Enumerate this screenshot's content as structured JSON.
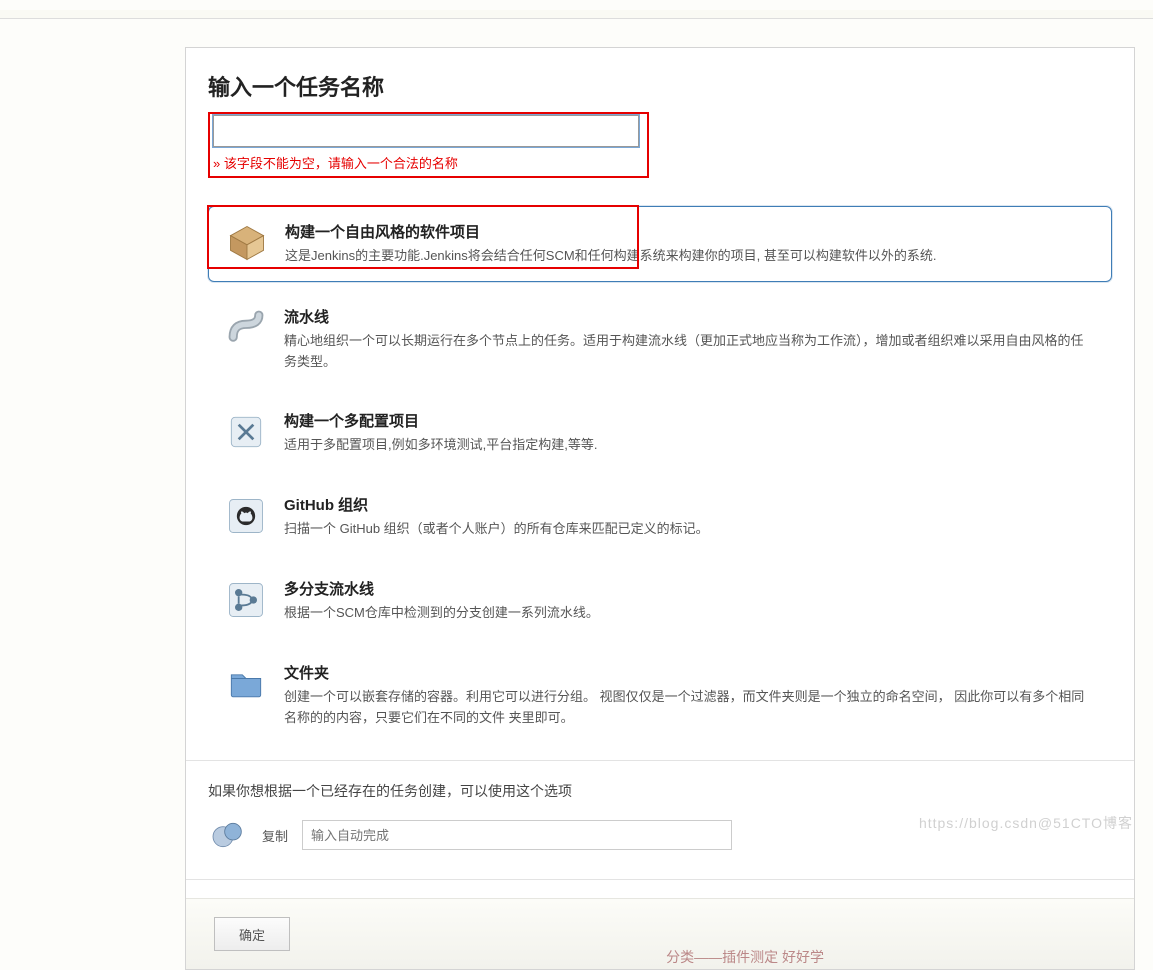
{
  "heading": "输入一个任务名称",
  "name_input": {
    "value": "",
    "placeholder": ""
  },
  "error_message": "» 该字段不能为空，请输入一个合法的名称",
  "job_types": [
    {
      "id": "freestyle",
      "title": "构建一个自由风格的软件项目",
      "desc": "这是Jenkins的主要功能.Jenkins将会结合任何SCM和任何构建系统来构建你的项目, 甚至可以构建软件以外的系统.",
      "selected": true
    },
    {
      "id": "pipeline",
      "title": "流水线",
      "desc": "精心地组织一个可以长期运行在多个节点上的任务。适用于构建流水线（更加正式地应当称为工作流），增加或者组织难以采用自由风格的任务类型。"
    },
    {
      "id": "matrix",
      "title": "构建一个多配置项目",
      "desc": "适用于多配置项目,例如多环境测试,平台指定构建,等等."
    },
    {
      "id": "github-org",
      "title": "GitHub 组织",
      "desc": "扫描一个 GitHub 组织（或者个人账户）的所有仓库来匹配已定义的标记。"
    },
    {
      "id": "multibranch",
      "title": "多分支流水线",
      "desc": "根据一个SCM仓库中检测到的分支创建一系列流水线。"
    },
    {
      "id": "folder",
      "title": "文件夹",
      "desc": "创建一个可以嵌套存储的容器。利用它可以进行分组。 视图仅仅是一个过滤器，而文件夹则是一个独立的命名空间， 因此你可以有多个相同名称的的内容，只要它们在不同的文件 夹里即可。"
    }
  ],
  "copy_section": {
    "hint": "如果你想根据一个已经存在的任务创建，可以使用这个选项",
    "label": "复制",
    "placeholder": "输入自动完成"
  },
  "footer": {
    "ok": "确定"
  },
  "watermark": "https://blog.csdn@51CTO博客",
  "footer_teaser": "分类——插件测定 好好学"
}
